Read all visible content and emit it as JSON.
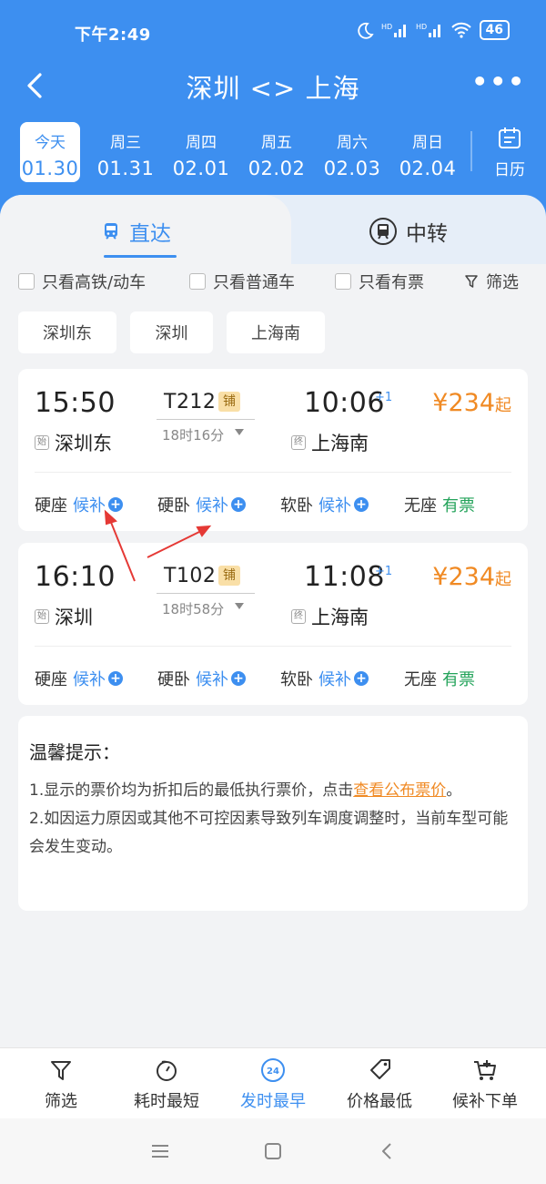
{
  "status": {
    "time": "下午2:49",
    "battery": "46"
  },
  "nav": {
    "title": "深圳 <> 上海"
  },
  "dates": [
    {
      "weekday": "今天",
      "date": "01.30"
    },
    {
      "weekday": "周三",
      "date": "01.31"
    },
    {
      "weekday": "周四",
      "date": "02.01"
    },
    {
      "weekday": "周五",
      "date": "02.02"
    },
    {
      "weekday": "周六",
      "date": "02.03"
    },
    {
      "weekday": "周日",
      "date": "02.04"
    }
  ],
  "calendar_label": "日历",
  "tabs": {
    "direct": "直达",
    "transfer": "中转"
  },
  "filters": {
    "highspeed": "只看高铁/动车",
    "normal": "只看普通车",
    "available": "只看有票",
    "filter": "筛选"
  },
  "stations": [
    "深圳东",
    "深圳",
    "上海南"
  ],
  "trains": [
    {
      "dep_time": "15:50",
      "arr_time": "10:06",
      "plus_day": "+1",
      "train_no": "T212",
      "tag": "铺",
      "duration": "18时16分",
      "price": "¥234",
      "price_suffix": "起",
      "from_badge": "始",
      "from": "深圳东",
      "to_badge": "终",
      "to": "上海南",
      "seats": [
        {
          "type": "硬座",
          "status": "候补"
        },
        {
          "type": "硬卧",
          "status": "候补"
        },
        {
          "type": "软卧",
          "status": "候补"
        },
        {
          "type": "无座",
          "status": "有票"
        }
      ]
    },
    {
      "dep_time": "16:10",
      "arr_time": "11:08",
      "plus_day": "+1",
      "train_no": "T102",
      "tag": "铺",
      "duration": "18时58分",
      "price": "¥234",
      "price_suffix": "起",
      "from_badge": "始",
      "from": "深圳",
      "to_badge": "终",
      "to": "上海南",
      "seats": [
        {
          "type": "硬座",
          "status": "候补"
        },
        {
          "type": "硬卧",
          "status": "候补"
        },
        {
          "type": "软卧",
          "status": "候补"
        },
        {
          "type": "无座",
          "status": "有票"
        }
      ]
    }
  ],
  "tips": {
    "title": "温馨提示：",
    "line1_pre": "1.显示的票价均为折扣后的最低执行票价，点击",
    "line1_link": "查看公布票价",
    "line1_post": "。",
    "line2": "2.如因运力原因或其他不可控因素导致列车调度调整时，当前车型可能会发生变动。"
  },
  "bottom": [
    {
      "label": "筛选",
      "icon": "filter-icon"
    },
    {
      "label": "耗时最短",
      "icon": "timer-icon"
    },
    {
      "label": "发时最早",
      "icon": "clock-24-icon",
      "badge": "24"
    },
    {
      "label": "价格最低",
      "icon": "price-tag-icon"
    },
    {
      "label": "候补下单",
      "icon": "cart-add-icon"
    }
  ],
  "colors": {
    "primary": "#3d8ff0",
    "price": "#f08a24",
    "available": "#23a35a"
  }
}
